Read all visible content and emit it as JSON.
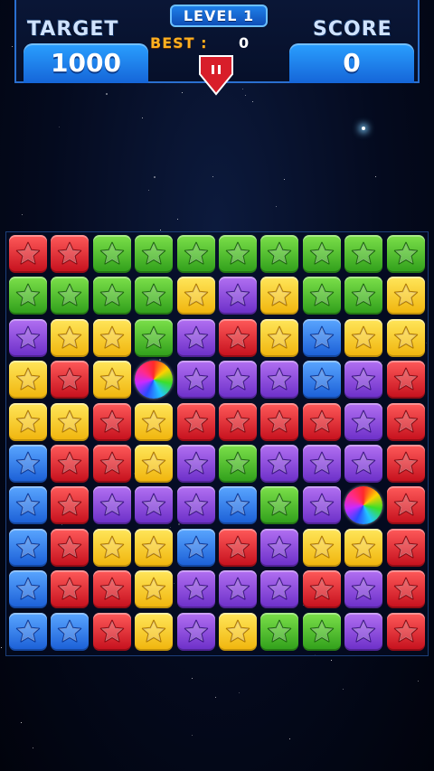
{
  "header": {
    "target_label": "TARGET",
    "target_value": "1000",
    "level_label": "LEVEL 1",
    "best_label": "BEST :",
    "best_value": "0",
    "score_label": "SCORE",
    "score_value": "0"
  },
  "colors": {
    "red": "#e0202c",
    "green": "#4cc22e",
    "yellow": "#f8d020",
    "purple": "#8e46dc",
    "blue": "#2f7ae8",
    "header_accent": "#1e7fe8",
    "best_label_color": "#ffb020"
  },
  "board": {
    "columns": 10,
    "rows": 10,
    "grid": [
      [
        "red",
        "red",
        "green",
        "green",
        "green",
        "green",
        "green",
        "green",
        "green",
        "green"
      ],
      [
        "green",
        "green",
        "green",
        "green",
        "yellow",
        "purple",
        "yellow",
        "green",
        "green",
        "yellow"
      ],
      [
        "purple",
        "yellow",
        "yellow",
        "green",
        "purple",
        "red",
        "yellow",
        "blue",
        "yellow",
        "yellow"
      ],
      [
        "yellow",
        "red",
        "yellow",
        "rainbow",
        "purple",
        "purple",
        "purple",
        "blue",
        "purple",
        "red"
      ],
      [
        "yellow",
        "yellow",
        "red",
        "yellow",
        "red",
        "red",
        "red",
        "red",
        "purple",
        "red"
      ],
      [
        "blue",
        "red",
        "red",
        "yellow",
        "purple",
        "green",
        "purple",
        "purple",
        "purple",
        "red"
      ],
      [
        "blue",
        "red",
        "purple",
        "purple",
        "purple",
        "blue",
        "green",
        "purple",
        "rainbow",
        "red"
      ],
      [
        "blue",
        "red",
        "yellow",
        "yellow",
        "blue",
        "red",
        "purple",
        "yellow",
        "yellow",
        "red"
      ],
      [
        "blue",
        "red",
        "red",
        "yellow",
        "purple",
        "purple",
        "purple",
        "red",
        "purple",
        "red"
      ],
      [
        "blue",
        "blue",
        "red",
        "yellow",
        "purple",
        "yellow",
        "green",
        "green",
        "purple",
        "red"
      ]
    ]
  },
  "icons": {
    "tile_icon": "star-icon",
    "special_icon": "rainbow-ball-icon",
    "pause_icon": "pause-icon"
  }
}
